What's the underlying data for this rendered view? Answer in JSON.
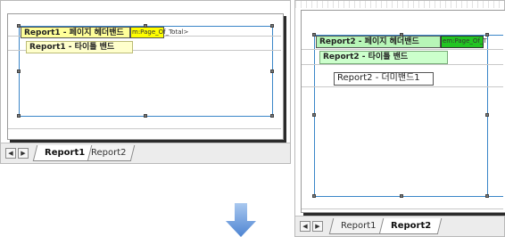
{
  "left_panel": {
    "page_header_band": "Report1 - 페이지 헤더밴드",
    "page_header_field": "m:Page_Of_Total>",
    "title_band": "Report1 - 타이틀 밴드",
    "tabs": [
      {
        "label": "Report1",
        "active": true
      },
      {
        "label": "Report2",
        "active": false
      }
    ]
  },
  "right_panel": {
    "page_header_band": "Report2 - 페이지 헤더밴드",
    "page_header_field": "em:Page_Of_T",
    "title_band": "Report2 - 타이틀 밴드",
    "dummy_band": "Report2 - 더미밴드1",
    "tabs": [
      {
        "label": "Report1",
        "active": false
      },
      {
        "label": "Report2",
        "active": true
      }
    ]
  },
  "nav_buttons": {
    "prev": "◀",
    "next": "▶"
  },
  "colors": {
    "page_header_band_left": "#ffff99",
    "page_header_field_left": "#ffff00",
    "title_band": "#ffffcc",
    "page_header_band_right": "#b7f5b7",
    "page_header_field_right": "#22c422",
    "title_band_right": "#ccffcc",
    "guide": "#3a86c8",
    "arrow": "#6f9fdc"
  },
  "icons": {
    "arrow": "down-arrow-icon"
  }
}
